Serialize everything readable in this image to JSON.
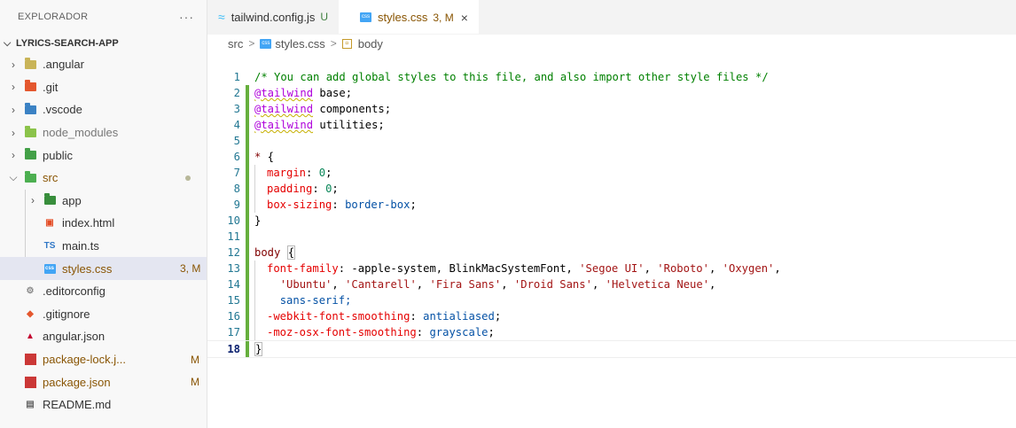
{
  "sidebar": {
    "title": "EXPLORADOR",
    "more": "···",
    "root": "LYRICS-SEARCH-APP",
    "items": [
      {
        "label": ".angular",
        "badge": ""
      },
      {
        "label": ".git",
        "badge": ""
      },
      {
        "label": ".vscode",
        "badge": ""
      },
      {
        "label": "node_modules",
        "badge": ""
      },
      {
        "label": "public",
        "badge": ""
      },
      {
        "label": "src",
        "badge": ""
      },
      {
        "label": "app",
        "badge": ""
      },
      {
        "label": "index.html",
        "badge": ""
      },
      {
        "label": "main.ts",
        "badge": ""
      },
      {
        "label": "styles.css",
        "badge": "3, M"
      },
      {
        "label": ".editorconfig",
        "badge": ""
      },
      {
        "label": ".gitignore",
        "badge": ""
      },
      {
        "label": "angular.json",
        "badge": ""
      },
      {
        "label": "package-lock.j...",
        "badge": "M"
      },
      {
        "label": "package.json",
        "badge": "M"
      },
      {
        "label": "README.md",
        "badge": ""
      }
    ],
    "ts_icon": "TS"
  },
  "tabs": [
    {
      "label": "tailwind.config.js",
      "suffix": "U",
      "icon": "tailwind-icon"
    },
    {
      "label": "styles.css",
      "suffix": "3, M",
      "icon": "css-file-icon",
      "close": "×"
    }
  ],
  "breadcrumb": {
    "parts": [
      "src",
      "styles.css",
      "body"
    ],
    "sep": ">"
  },
  "editor": {
    "lines": [
      {
        "n": "1",
        "t": "/* You can add global styles to this file, and also import other style files */"
      },
      {
        "n": "2",
        "at": "@tailwind",
        "rest": " base;"
      },
      {
        "n": "3",
        "at": "@tailwind",
        "rest": " components;"
      },
      {
        "n": "4",
        "at": "@tailwind",
        "rest": " utilities;"
      },
      {
        "n": "5"
      },
      {
        "n": "6",
        "sel": "*",
        "rest": " {"
      },
      {
        "n": "7",
        "prop": "margin",
        "val": "0"
      },
      {
        "n": "8",
        "prop": "padding",
        "val": "0"
      },
      {
        "n": "9",
        "prop": "box-sizing",
        "val": "border-box"
      },
      {
        "n": "10",
        "t": "}"
      },
      {
        "n": "11"
      },
      {
        "n": "12",
        "sel": "body",
        "rest": "{"
      },
      {
        "n": "13",
        "prop": "font-family",
        "rest": " -apple-system, BlinkMacSystemFont, ",
        "strs": [
          "'Segoe UI'",
          "'Roboto'",
          "'Oxygen'"
        ]
      },
      {
        "n": "14",
        "strs": [
          "'Ubuntu'",
          "'Cantarell'",
          "'Fira Sans'",
          "'Droid Sans'",
          "'Helvetica Neue'"
        ]
      },
      {
        "n": "15",
        "t": "sans-serif;"
      },
      {
        "n": "16",
        "prop": "-webkit-font-smoothing",
        "val": "antialiased"
      },
      {
        "n": "17",
        "prop": "-moz-osx-font-smoothing",
        "val": "grayscale"
      },
      {
        "n": "18",
        "t": "}"
      }
    ]
  },
  "colors": {
    "accent_modified": "#66af3d",
    "sidebar_bg": "#f8f8f8",
    "selected_row": "#e4e6f1"
  }
}
